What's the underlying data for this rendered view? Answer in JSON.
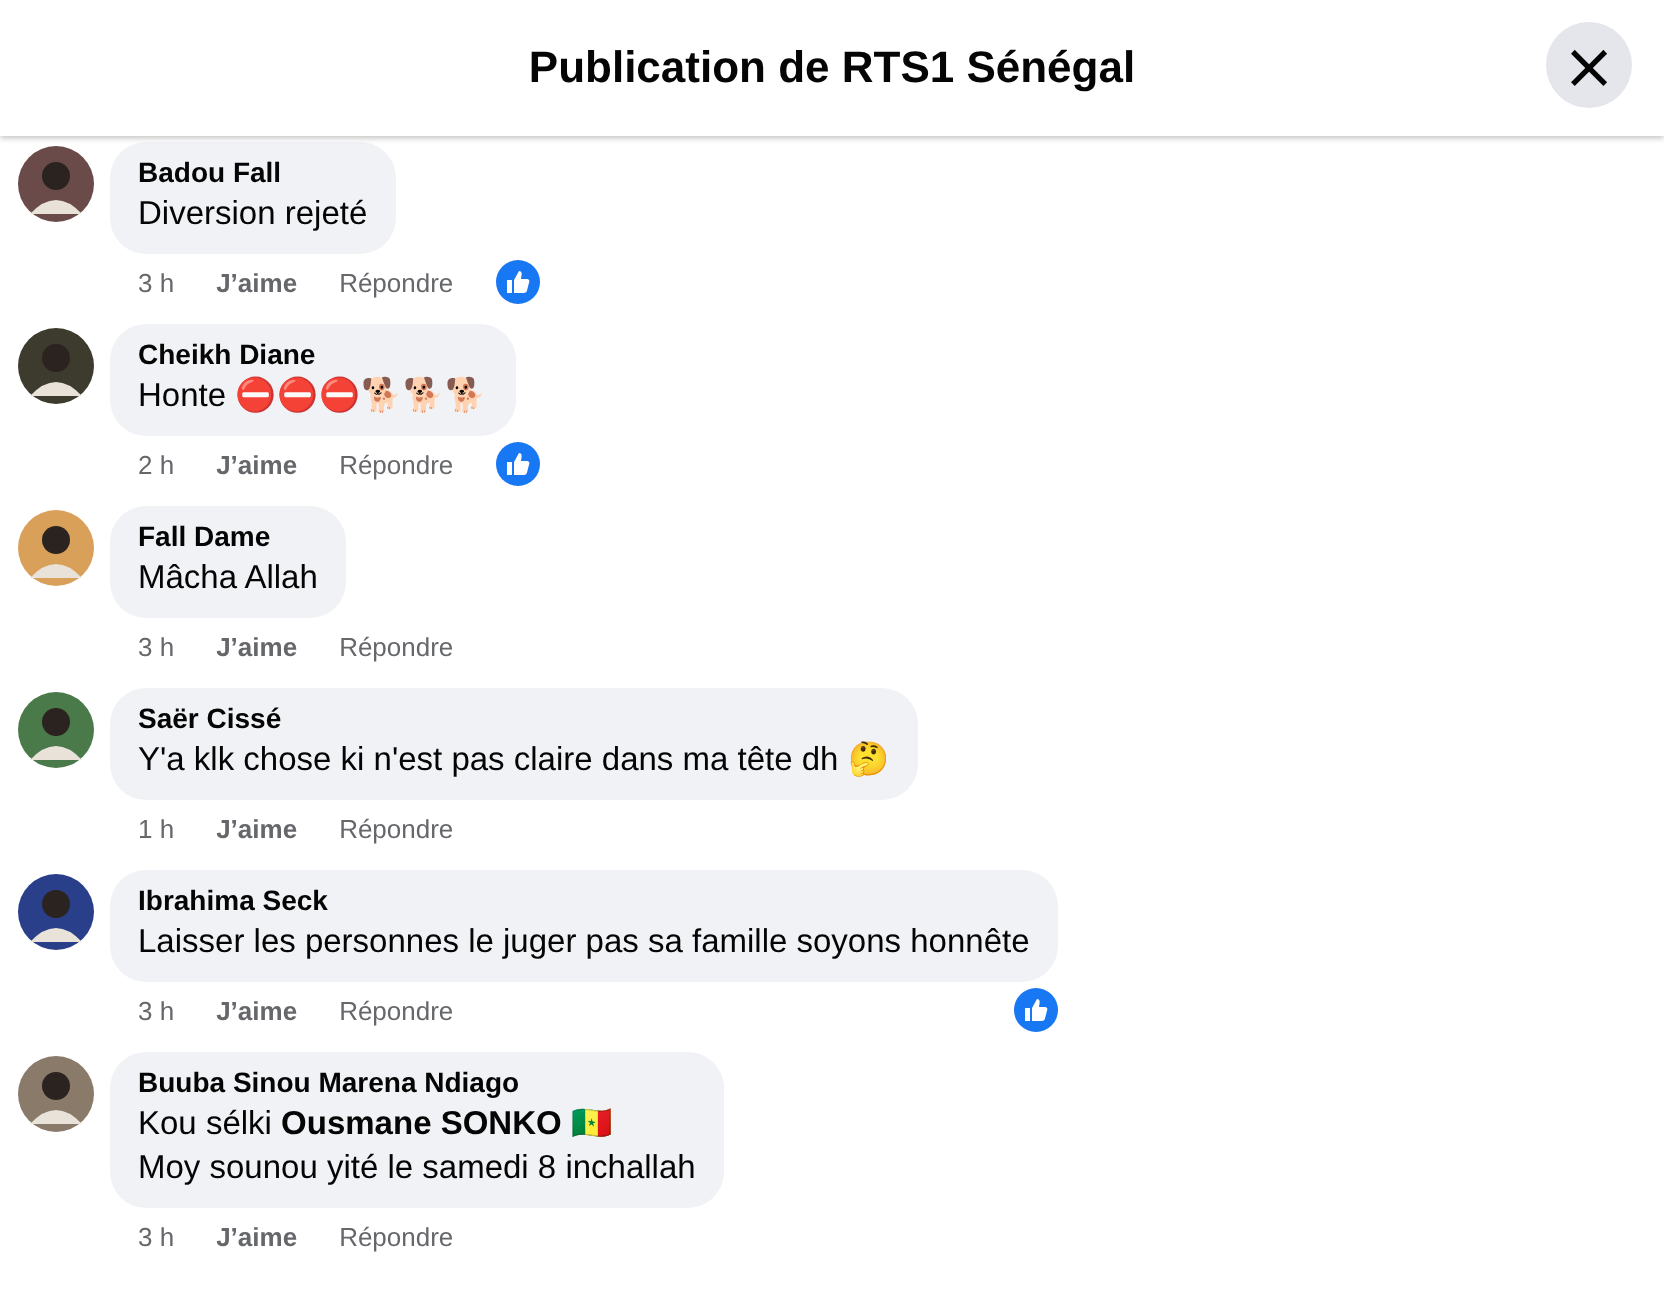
{
  "header": {
    "title": "Publication de RTS1 Sénégal",
    "close_icon": "×"
  },
  "comments": [
    {
      "author": "Badou Fall",
      "lines": [
        "Diversion rejeté"
      ],
      "time": "3 h",
      "like": "J’aime",
      "reply": "Répondre",
      "liked": true
    },
    {
      "author": "Cheikh Diane",
      "lines": [
        "Honte ⛔⛔⛔🐕🐕🐕"
      ],
      "time": "2 h",
      "like": "J’aime",
      "reply": "Répondre",
      "liked": true
    },
    {
      "author": "Fall Dame",
      "lines": [
        "Mâcha Allah"
      ],
      "time": "3 h",
      "like": "J’aime",
      "reply": "Répondre",
      "liked": false
    },
    {
      "author": "Saër Cissé",
      "lines": [
        "Y'a klk chose ki n'est pas claire dans ma tête dh 🤔"
      ],
      "time": "1 h",
      "like": "J’aime",
      "reply": "Répondre",
      "liked": false
    },
    {
      "author": "Ibrahima Seck",
      "lines": [
        "Laisser les personnes le juger pas sa famille soyons honnête"
      ],
      "time": "3 h",
      "like": "J’aime",
      "reply": "Répondre",
      "liked": true
    },
    {
      "author": "Buuba Sinou Marena Ndiago",
      "lines": [
        "Kou sélki **Ousmane SONKO** 🇸🇳",
        "Moy sounou yité le samedi 8 inchallah"
      ],
      "time": "3 h",
      "like": "J’aime",
      "reply": "Répondre",
      "liked": false
    }
  ]
}
